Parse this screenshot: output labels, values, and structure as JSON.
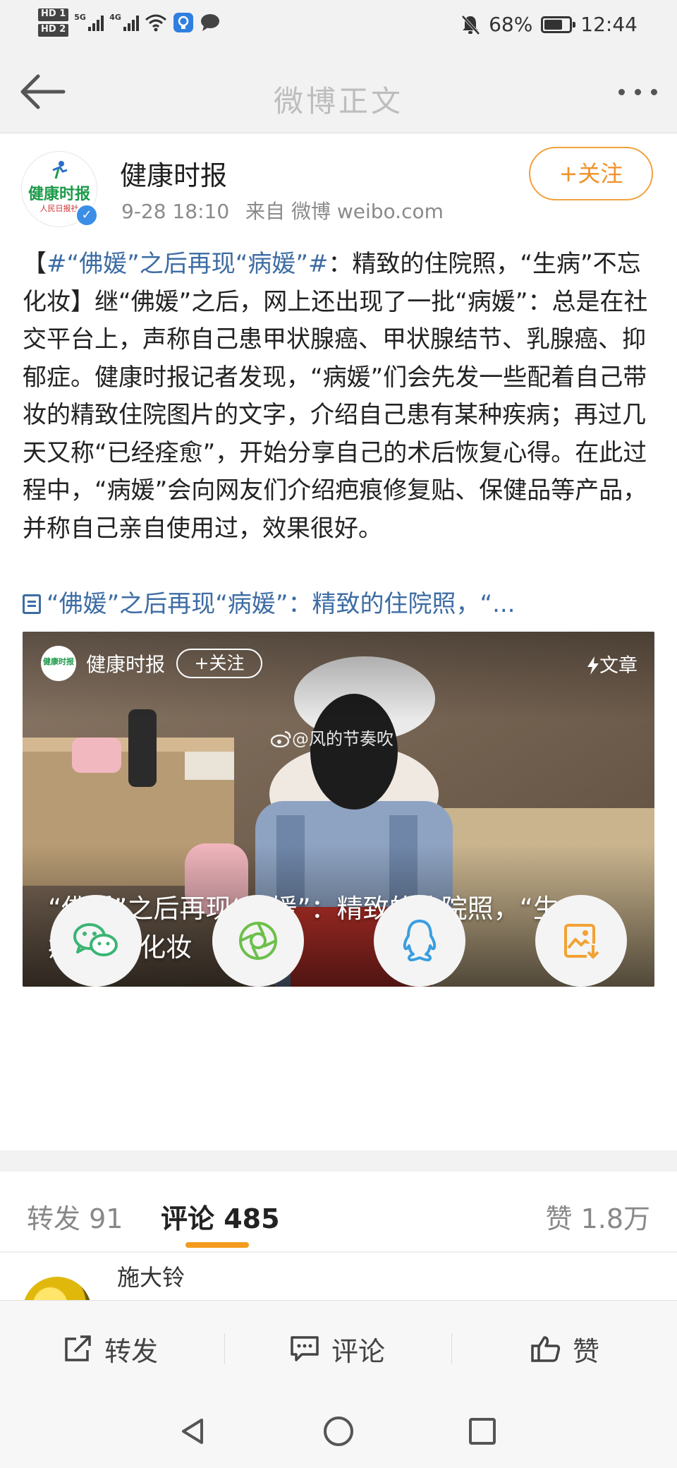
{
  "status_bar": {
    "sim1": "HD 1",
    "sim2": "HD 2",
    "net1": "5G",
    "net2": "4G",
    "battery": "68%",
    "time": "12:44"
  },
  "nav": {
    "title": "微博正文",
    "back_icon": "arrow-left-icon",
    "more_icon": "more-dots-icon"
  },
  "post": {
    "author": "健康时报",
    "avatar_text": "健康时报",
    "avatar_sub": "人民日报社",
    "time": "9-28 18:10",
    "source": "来自 微博 weibo.com",
    "follow_label": "+关注",
    "text_tag": "#“佛媛”之后再现“病媛”#",
    "text_open": "【",
    "text_body": "：精致的住院照，“生病”不忘化妆】继“佛媛”之后，网上还出现了一批“病媛”：总是在社交平台上，声称自己患甲状腺癌、甲状腺结节、乳腺癌、抑郁症。健康时报记者发现，“病媛”们会先发一些配着自己带妆的精致住院图片的文字，介绍自己患有某种疾病；再过几天又称“已经痊愈”，开始分享自己的术后恢复心得。在此过程中，“病媛”会向网友们介绍疤痕修复贴、保健品等产品，并称自己亲自使用过，效果很好。",
    "link_text": "“佛媛”之后再现“病媛”：精致的住院照，“..."
  },
  "card": {
    "author": "健康时报",
    "follow_label": "+关注",
    "type_label": "文章",
    "watermark": "@风的节奏吹",
    "caption": "“佛媛”之后再现“病媛”：精致的住院照，“生病”不忘化妆"
  },
  "share": [
    {
      "name": "wechat-icon",
      "color": "#3cb574"
    },
    {
      "name": "moments-icon",
      "color": "#6cc04a"
    },
    {
      "name": "qq-icon",
      "color": "#3a9ee0"
    },
    {
      "name": "save-image-icon",
      "color": "#f2a233"
    }
  ],
  "tabs": {
    "repost": "转发 91",
    "comment": "评论 485",
    "like": "赞 1.8万"
  },
  "comment_preview": {
    "name": "施大铃"
  },
  "actions": {
    "repost": "转发",
    "comment": "评论",
    "like": "赞"
  },
  "colors": {
    "accent": "#f39b1f",
    "link": "#3d6ca3"
  }
}
